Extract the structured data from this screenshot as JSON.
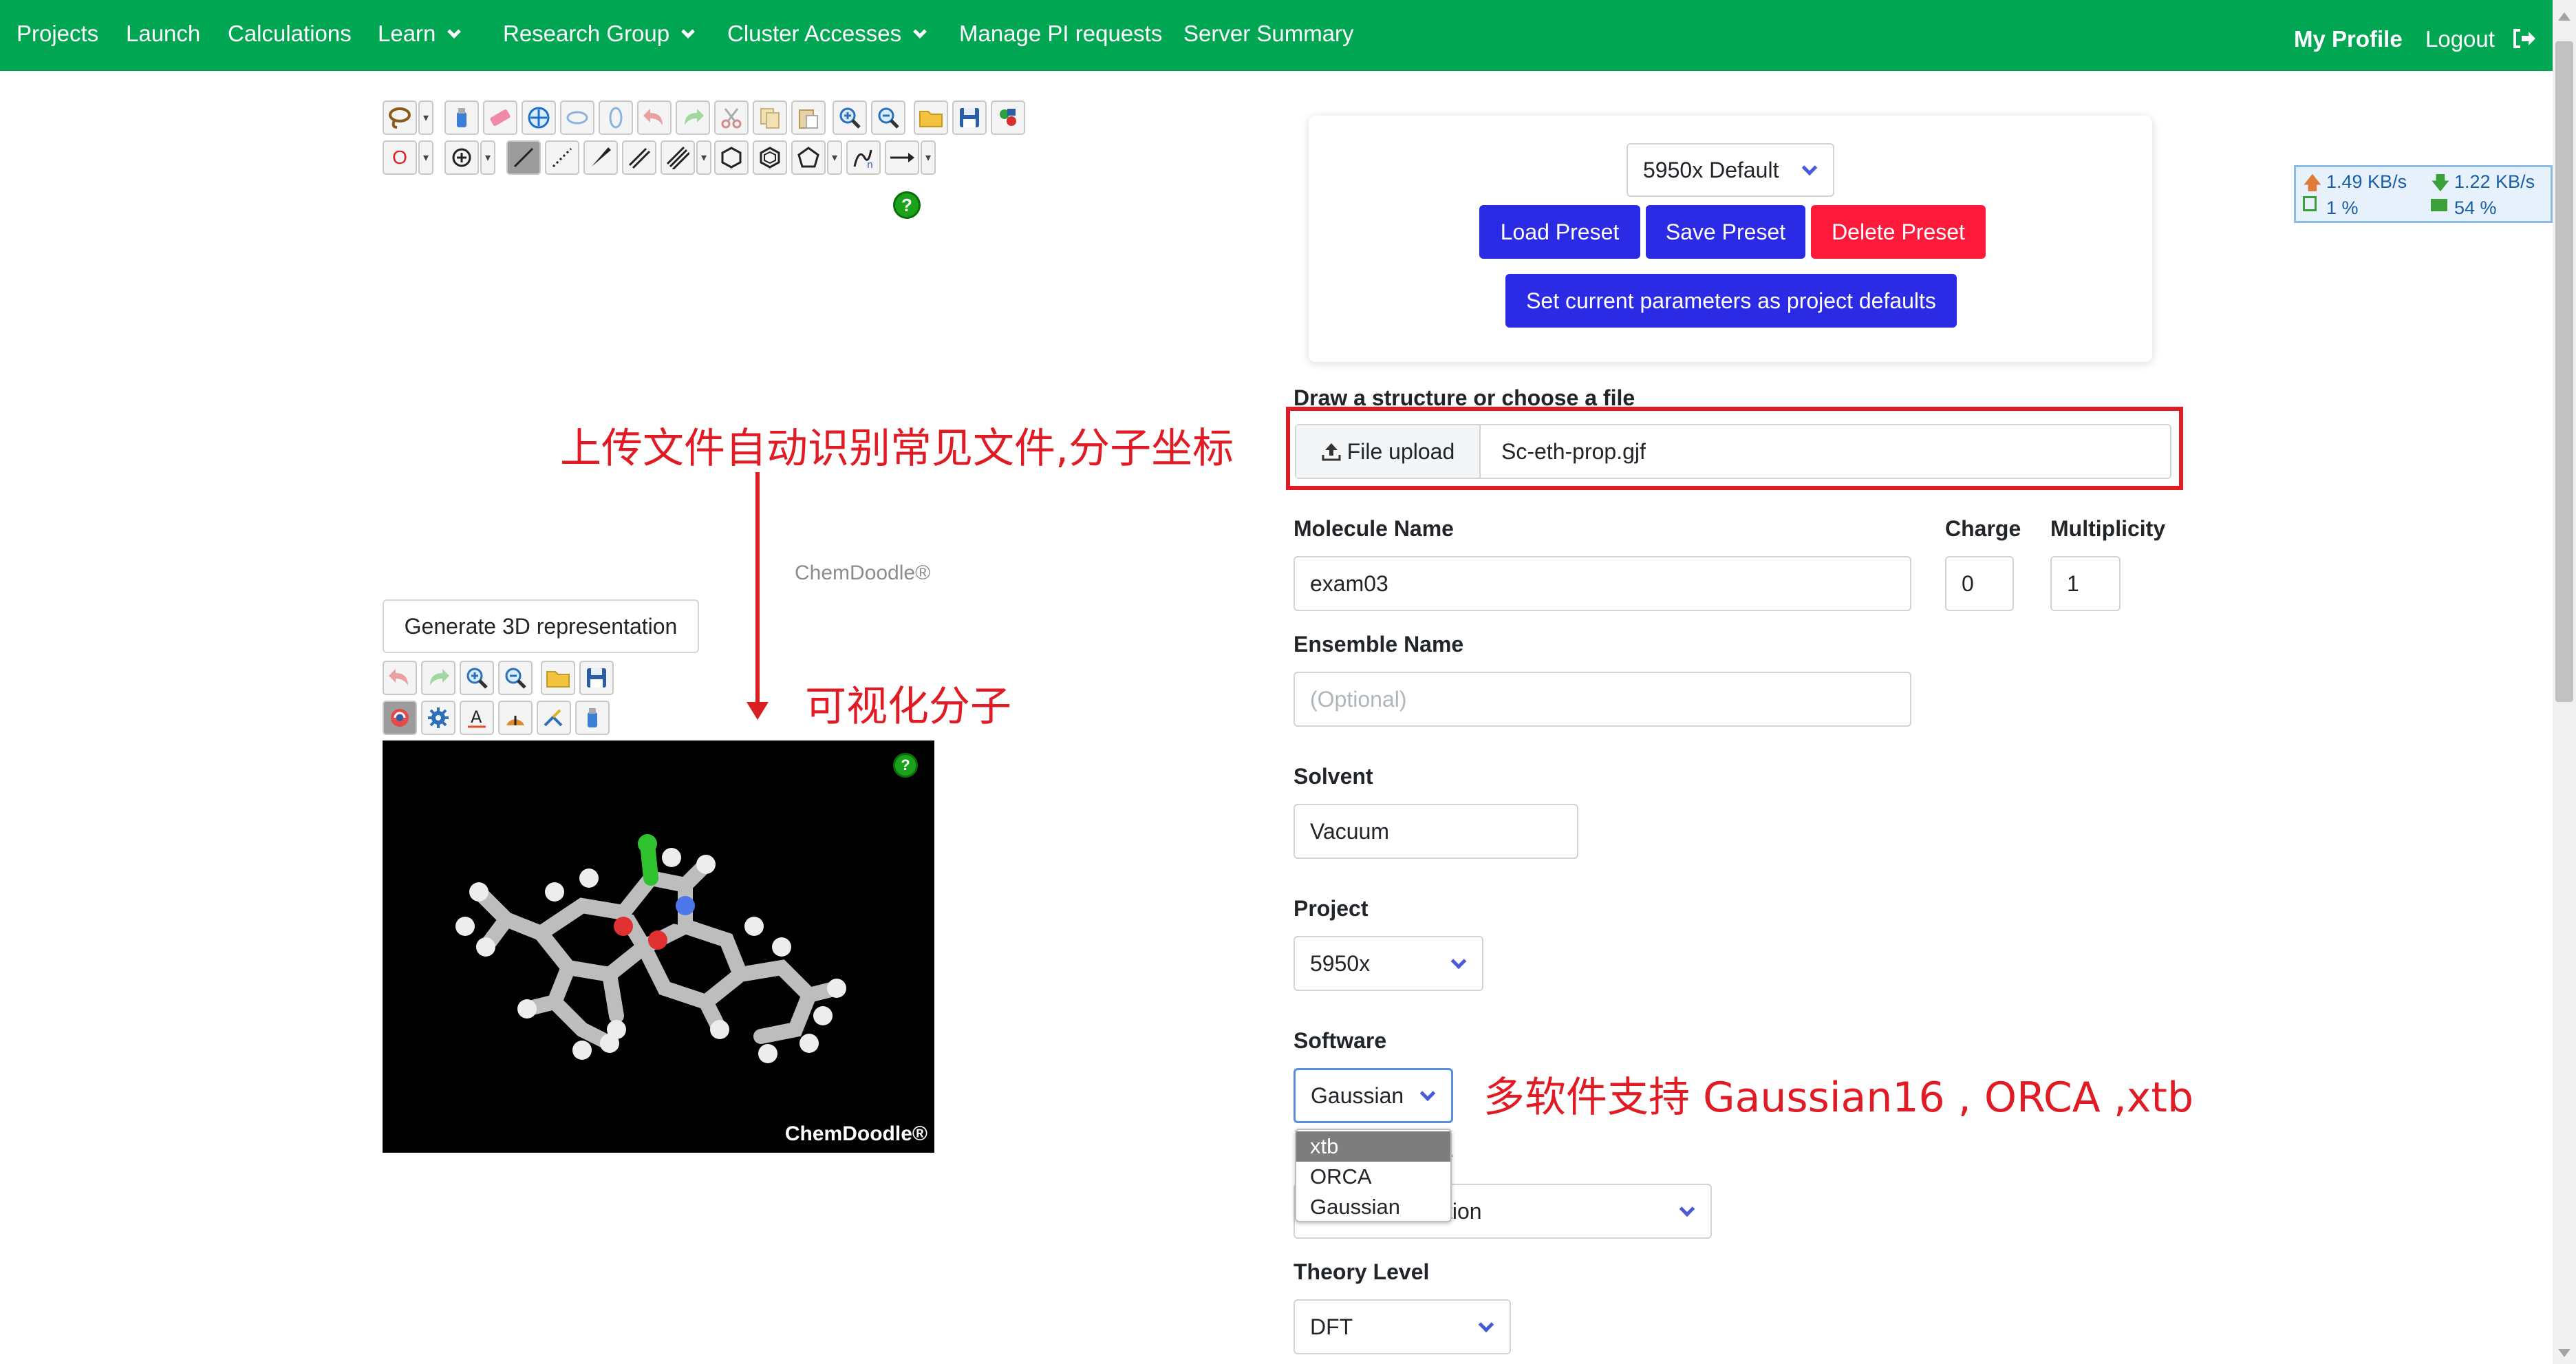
{
  "nav": {
    "items": [
      "Projects",
      "Launch",
      "Calculations",
      "Learn",
      "Research Group",
      "Cluster Accesses",
      "Manage PI requests",
      "Server Summary"
    ],
    "profile": "My Profile",
    "logout": "Logout"
  },
  "netstats": {
    "upload": "1.49 KB/s",
    "download": "1.22 KB/s",
    "cpu": "1 %",
    "mem": "54 %"
  },
  "sketcher": {
    "atom_label": "O",
    "help": "?",
    "brand": "ChemDoodle®"
  },
  "viewer": {
    "generate_button": "Generate 3D representation",
    "brand": "ChemDoodle®",
    "help": "?"
  },
  "presets": {
    "selected": "5950x Default",
    "load": "Load Preset",
    "save": "Save Preset",
    "delete": "Delete Preset",
    "set_defaults": "Set current parameters as project defaults"
  },
  "form": {
    "draw_label": "Draw a structure or choose a file",
    "file_upload_button": "File upload",
    "file_name": "Sc-eth-prop.gjf",
    "molecule_name_label": "Molecule Name",
    "molecule_name": "exam03",
    "charge_label": "Charge",
    "charge": "0",
    "multiplicity_label": "Multiplicity",
    "multiplicity": "1",
    "ensemble_label": "Ensemble Name",
    "ensemble_placeholder": "(Optional)",
    "solvent_label": "Solvent",
    "solvent": "Vacuum",
    "project_label": "Project",
    "project": "5950x",
    "software_label": "Software",
    "software": "Gaussian",
    "software_options": [
      "xtb",
      "ORCA",
      "Gaussian"
    ],
    "type_label_partial": "e",
    "type_value_partial": "tion",
    "theory_label": "Theory Level",
    "theory": "DFT"
  },
  "annotations": {
    "upload": "上传文件自动识别常见文件,分子坐标",
    "visualize": "可视化分子",
    "software": "多软件支持 Gaussian16 , ORCA ,xtb"
  }
}
